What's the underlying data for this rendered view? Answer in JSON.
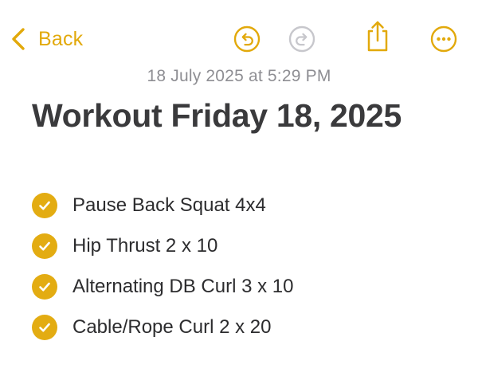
{
  "toolbar": {
    "back_label": "Back",
    "undo_icon": "undo-icon",
    "redo_icon": "redo-icon",
    "share_icon": "share-icon",
    "more_icon": "ellipsis-icon",
    "accent_color": "#e3ac12",
    "disabled_color": "#c7c7cc"
  },
  "note": {
    "timestamp": "18 July 2025 at 5:29 PM",
    "title": "Workout Friday 18, 2025",
    "checklist": [
      {
        "text": "Pause Back Squat 4x4",
        "checked": true
      },
      {
        "text": "Hip Thrust 2 x 10",
        "checked": true
      },
      {
        "text": "Alternating DB Curl 3 x 10",
        "checked": true
      },
      {
        "text": "Cable/Rope Curl 2 x 20",
        "checked": true
      }
    ]
  }
}
